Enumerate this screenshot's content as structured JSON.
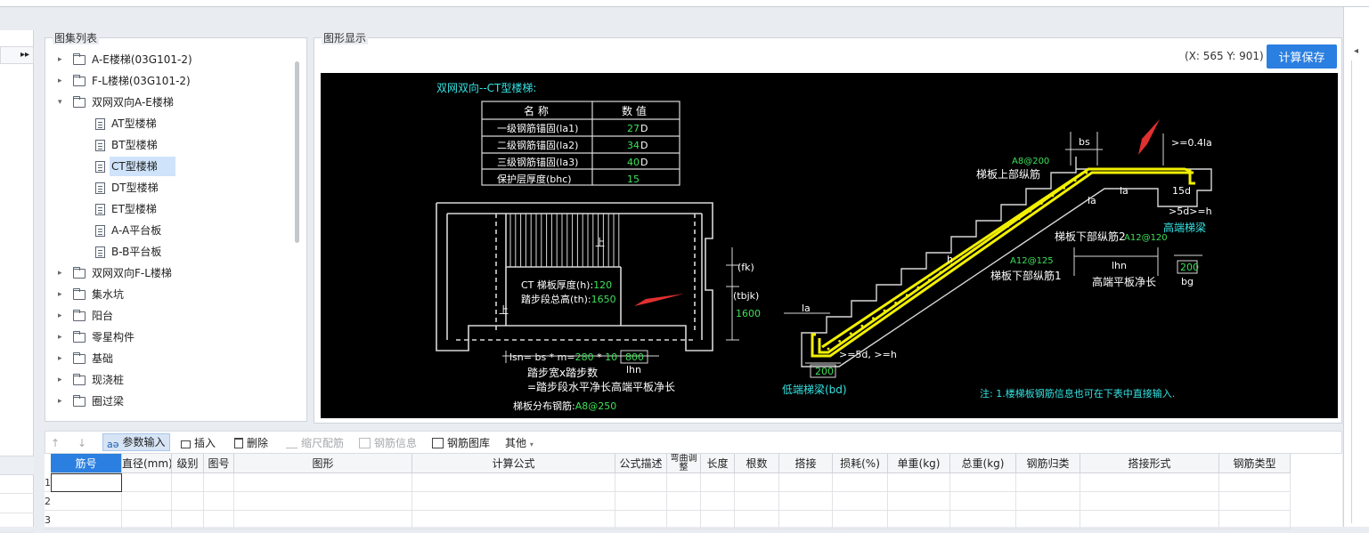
{
  "left_strip": {
    "toggle": "▸▸"
  },
  "tree_panel": {
    "title": "图集列表",
    "items": [
      {
        "label": "A-E楼梯(03G101-2)",
        "type": "folder",
        "expanded": false,
        "level": 0
      },
      {
        "label": "F-L楼梯(03G101-2)",
        "type": "folder",
        "expanded": false,
        "level": 0
      },
      {
        "label": "双网双向A-E楼梯",
        "type": "folder",
        "expanded": true,
        "level": 0
      },
      {
        "label": "AT型楼梯",
        "type": "doc",
        "level": 1
      },
      {
        "label": "BT型楼梯",
        "type": "doc",
        "level": 1
      },
      {
        "label": "CT型楼梯",
        "type": "doc",
        "level": 1,
        "selected": true
      },
      {
        "label": "DT型楼梯",
        "type": "doc",
        "level": 1
      },
      {
        "label": "ET型楼梯",
        "type": "doc",
        "level": 1
      },
      {
        "label": "A-A平台板",
        "type": "doc",
        "level": 1
      },
      {
        "label": "B-B平台板",
        "type": "doc",
        "level": 1
      },
      {
        "label": "双网双向F-L楼梯",
        "type": "folder",
        "expanded": false,
        "level": 0
      },
      {
        "label": "集水坑",
        "type": "folder",
        "expanded": false,
        "level": 0
      },
      {
        "label": "阳台",
        "type": "folder",
        "expanded": false,
        "level": 0
      },
      {
        "label": "零星构件",
        "type": "folder",
        "expanded": false,
        "level": 0
      },
      {
        "label": "基础",
        "type": "folder",
        "expanded": false,
        "level": 0
      },
      {
        "label": "现浇桩",
        "type": "folder",
        "expanded": false,
        "level": 0
      },
      {
        "label": "圈过梁",
        "type": "folder",
        "expanded": false,
        "level": 0
      }
    ]
  },
  "graphic_panel": {
    "title": "图形显示",
    "coord": "(X: 565 Y: 901)",
    "calc_save": "计算保存"
  },
  "drawing": {
    "title": "双网双向--CT型楼梯:",
    "table_header": [
      "名 称",
      "数 值"
    ],
    "table_rows": [
      {
        "name": "一级钢筋锚固(la1)",
        "value": "27",
        "unit": "D"
      },
      {
        "name": "二级钢筋锚固(la2)",
        "value": "34",
        "unit": "D"
      },
      {
        "name": "三级钢筋锚固(la3)",
        "value": "40",
        "unit": "D"
      },
      {
        "name": "保护层厚度(bhc)",
        "value": "15",
        "unit": ""
      }
    ],
    "plan_thickness_label": "CT 梯板厚度(h):",
    "plan_thickness_value": "120",
    "plan_height_label": "踏步段总高(th):",
    "plan_height_value": "1650",
    "up_label": "上",
    "fk": "(fk)",
    "tbjk": "(tbjk)",
    "plan_height_dim": "1600",
    "lsn_prefix": "lsn= bs * m=",
    "lsn_bs": "280",
    "lsn_m": "10",
    "lsn_box": "800",
    "lhn": "lhn",
    "step_desc1": "踏步宽x踏步数",
    "step_desc2": "=踏步段水平净长高端平板净长",
    "distrib_label": "梯板分布钢筋:",
    "distrib_value": "A8@250",
    "bs": "bs",
    "top_gt": ">=0.4la",
    "a8_200": "A8@200",
    "upper_long": "梯板上部纵筋",
    "la": "la",
    "d15": "15d",
    "d5h_top": ">5d>=h",
    "high_beam": "高端梯梁",
    "lower_long2": "梯板下部纵筋2",
    "a12_120": "A12@120",
    "a12_125": "A12@125",
    "lower_long1": "梯板下部纵筋1",
    "lhn2": "lhn",
    "high_flat": "高端平板净长",
    "dim200": "200",
    "bg": "bg",
    "h": "h",
    "d5h_low": ">=5d, >=h",
    "dim200_low": "200",
    "low_beam": "低端梯梁(bd)",
    "note": "注: 1.楼梯板钢筋信息也可在下表中直接输入."
  },
  "toolbar": {
    "up": "↑",
    "down": "↓",
    "param_input": "参数输入",
    "insert": "插入",
    "delete": "删除",
    "scale_rebar": "缩尺配筋",
    "rebar_info": "钢筋信息",
    "rebar_lib": "钢筋图库",
    "other": "其他"
  },
  "grid": {
    "columns": [
      "筋号",
      "直径(mm)",
      "级别",
      "图号",
      "图形",
      "计算公式",
      "公式描述",
      "弯曲调整",
      "长度",
      "根数",
      "搭接",
      "损耗(%)",
      "单重(kg)",
      "总重(kg)",
      "钢筋归类",
      "搭接形式",
      "钢筋类型"
    ],
    "row_numbers": [
      "1",
      "2",
      "3"
    ]
  },
  "colors": {
    "accent": "#2b7fe0",
    "dim_green": "#3ee05a",
    "rebar_yellow": "#f2f000",
    "cyan": "#36e3e3"
  }
}
